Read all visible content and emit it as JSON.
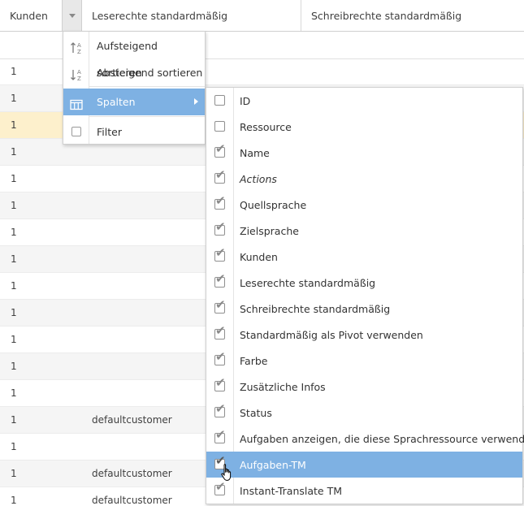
{
  "header": {
    "col_kunden": "Kunden",
    "col_read": "Leserechte standardmäßig",
    "col_write": "Schreibrechte standardmäßig"
  },
  "rows": [
    {
      "kunden": "1",
      "customer": ""
    },
    {
      "kunden": "1",
      "customer": ""
    },
    {
      "kunden": "1",
      "customer": ""
    },
    {
      "kunden": "1",
      "customer": ""
    },
    {
      "kunden": "1",
      "customer": ""
    },
    {
      "kunden": "1",
      "customer": ""
    },
    {
      "kunden": "1",
      "customer": ""
    },
    {
      "kunden": "1",
      "customer": ""
    },
    {
      "kunden": "1",
      "customer": ""
    },
    {
      "kunden": "1",
      "customer": ""
    },
    {
      "kunden": "1",
      "customer": ""
    },
    {
      "kunden": "1",
      "customer": ""
    },
    {
      "kunden": "1",
      "customer": ""
    },
    {
      "kunden": "1",
      "customer": "defaultcustomer"
    },
    {
      "kunden": "1",
      "customer": ""
    },
    {
      "kunden": "1",
      "customer": "defaultcustomer"
    },
    {
      "kunden": "1",
      "customer": "defaultcustomer"
    }
  ],
  "menu": {
    "sort_asc": "Aufsteigend sortieren",
    "sort_desc": "Absteigend sortieren",
    "columns": "Spalten",
    "filter": "Filter"
  },
  "columns_menu": [
    {
      "label": "ID",
      "checked": false
    },
    {
      "label": "Ressource",
      "checked": false
    },
    {
      "label": "Name",
      "checked": true
    },
    {
      "label": "Actions",
      "checked": true,
      "italic": true
    },
    {
      "label": "Quellsprache",
      "checked": true
    },
    {
      "label": "Zielsprache",
      "checked": true
    },
    {
      "label": "Kunden",
      "checked": true
    },
    {
      "label": "Leserechte standardmäßig",
      "checked": true
    },
    {
      "label": "Schreibrechte standardmäßig",
      "checked": true
    },
    {
      "label": "Standardmäßig als Pivot verwenden",
      "checked": true
    },
    {
      "label": "Farbe",
      "checked": true
    },
    {
      "label": "Zusätzliche Infos",
      "checked": true
    },
    {
      "label": "Status",
      "checked": true
    },
    {
      "label": "Aufgaben anzeigen, die diese Sprachressource verwenden",
      "checked": true
    },
    {
      "label": "Aufgaben-TM",
      "checked": true,
      "highlighted": true
    },
    {
      "label": "Instant-Translate TM",
      "checked": true
    }
  ],
  "colors": {
    "highlight": "#7eb1e3",
    "selected_row": "#fdf0cc",
    "alt_row": "#f5f5f5"
  }
}
